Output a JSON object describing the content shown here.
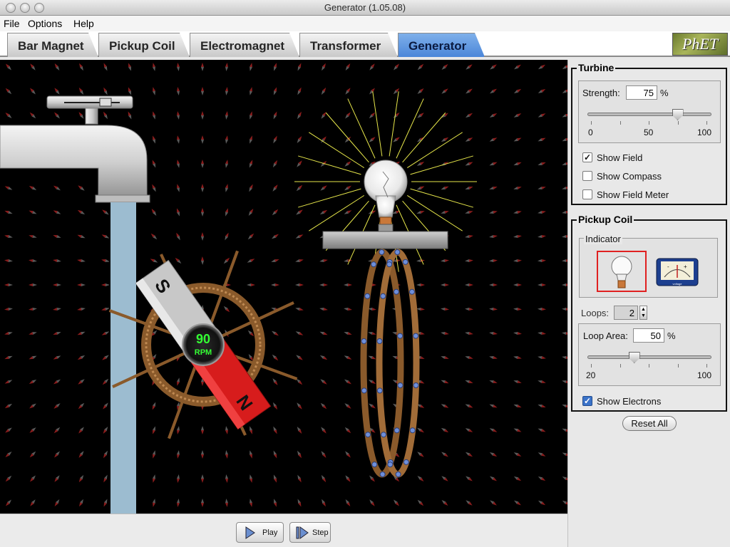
{
  "window": {
    "title": "Generator (1.05.08)"
  },
  "menu": {
    "file": "File",
    "options": "Options",
    "help": "Help"
  },
  "tabs": [
    {
      "label": "Bar Magnet"
    },
    {
      "label": "Pickup Coil"
    },
    {
      "label": "Electromagnet"
    },
    {
      "label": "Transformer"
    },
    {
      "label": "Generator",
      "active": true
    }
  ],
  "logo": "PhET",
  "canvas": {
    "rpm_value": "90",
    "rpm_unit": "RPM",
    "magnet_south": "S",
    "magnet_north": "N"
  },
  "controls": {
    "play_label": "Play",
    "step_label": "Step"
  },
  "turbine": {
    "title": "Turbine",
    "strength_label": "Strength:",
    "strength_value": "75",
    "strength_unit": "%",
    "strength_min": "0",
    "strength_mid": "50",
    "strength_max": "100",
    "strength_fraction": 0.75,
    "show_field_label": "Show Field",
    "show_field": true,
    "show_compass_label": "Show Compass",
    "show_compass": false,
    "show_field_meter_label": "Show Field Meter",
    "show_field_meter": false
  },
  "pickup_coil": {
    "title": "Pickup Coil",
    "indicator_label": "Indicator",
    "indicator_selected": "lightbulb",
    "voltmeter_minus": "-",
    "voltmeter_plus": "+",
    "voltmeter_caption": "voltage",
    "loops_label": "Loops:",
    "loops_value": "2",
    "loop_area_label": "Loop Area:",
    "loop_area_value": "50",
    "loop_area_unit": "%",
    "loop_area_min": "20",
    "loop_area_max": "100",
    "loop_area_fraction": 0.375,
    "show_electrons_label": "Show Electrons",
    "show_electrons": true
  },
  "reset_label": "Reset All",
  "colors": {
    "active_tab": "#4b86d9",
    "canvas_bg": "#000000",
    "rpm_readout": "#33ff33",
    "magnet_north": "#d71c1c",
    "magnet_south": "#c8c8c8",
    "coil": "#8a5a2b",
    "electron": "#6f8fd9",
    "bulb_rays": "#e6e64a",
    "water": "#9cbcd0",
    "selected_indicator_border": "#e02020"
  },
  "icons": [
    "play-icon",
    "step-icon",
    "lightbulb-icon",
    "voltmeter-icon",
    "faucet-icon",
    "water-wheel-icon",
    "bar-magnet-icon",
    "pickup-coil-icon",
    "light-bulb-icon"
  ]
}
